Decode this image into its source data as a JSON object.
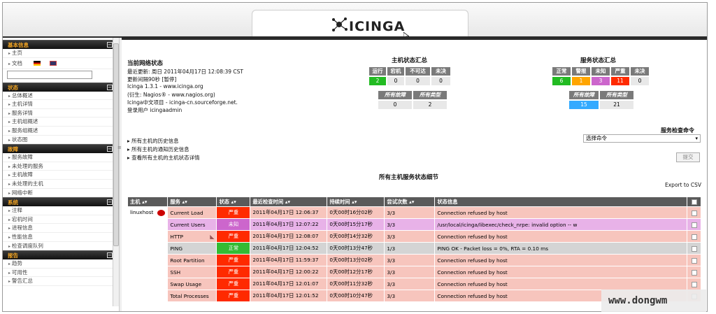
{
  "brand": {
    "logo_text": "ICINGA"
  },
  "sidebar": {
    "sections": [
      {
        "title": "基本信息",
        "items": [
          "主页"
        ]
      },
      {
        "title": "状态",
        "items": [
          "总体概述",
          "主机详情",
          "服务详情",
          "主机组概述",
          "服务组概述",
          "状态图"
        ]
      },
      {
        "title": "故障",
        "items": [
          "服务故障",
          "未处理的服务",
          "主机故障",
          "未处理的主机",
          "网络中断"
        ]
      },
      {
        "title": "系统",
        "items": [
          "注释",
          "宕机时间",
          "进程信息",
          "性能信息",
          "检查调度队列"
        ]
      },
      {
        "title": "报告",
        "items": [
          "趋势",
          "可用性",
          "警告汇总"
        ]
      }
    ],
    "docs_label": "文档",
    "search_value": ""
  },
  "info": {
    "title": "当前网络状态",
    "updated": "最近更新: 周日 2011年04月17日 12:08:39 CST",
    "interval": "更新间隔90秒 [暂停]",
    "version": "Icinga 1.3.1 - www.icinga.org",
    "fork": "(衍生: Nagios® - www.nagios.org)",
    "cn_project": "Icinga中文项目 - icinga-cn.sourceforge.net.",
    "user": "登录用户 icingaadmin"
  },
  "host_summary": {
    "title": "主机状态汇总",
    "headers": [
      "运行",
      "宕机",
      "不可达",
      "未决"
    ],
    "values": [
      "2",
      "0",
      "0",
      "0"
    ],
    "sub_headers": [
      "所有故障",
      "所有类型"
    ],
    "sub_values": [
      "0",
      "2"
    ]
  },
  "service_summary": {
    "title": "服务状态汇总",
    "headers": [
      "正常",
      "警报",
      "未知",
      "严重",
      "未决"
    ],
    "values": [
      "6",
      "1",
      "3",
      "11",
      "0"
    ],
    "sub_headers": [
      "所有故障",
      "所有类型"
    ],
    "sub_values": [
      "15",
      "21"
    ]
  },
  "links": [
    "所有主机的历史信息",
    "所有主机的通知历史信息",
    "查看所有主机的主机状态详情"
  ],
  "command": {
    "title": "服务检查命令",
    "select_value": "选择命令",
    "submit": "提交"
  },
  "details": {
    "title": "所有主机服务状态细节",
    "export": "Export to CSV"
  },
  "table": {
    "headers": [
      "主机",
      "服务",
      "状态",
      "最近检查时间",
      "持续时间",
      "尝试次数",
      "状态信息"
    ],
    "host": "linuxhost",
    "rows": [
      {
        "service": "Current Load",
        "status": "严重",
        "kind": "crit",
        "last": "2011年04月17日 12:06:37",
        "dur": "0天00时16分02秒",
        "att": "3/3",
        "info": "Connection refused by host"
      },
      {
        "service": "Current Users",
        "status": "未知",
        "kind": "unk",
        "last": "2011年04月17日 12:07:22",
        "dur": "0天00时15分17秒",
        "att": "3/3",
        "info": "/usr/local/icinga/libexec/check_nrpe: invalid option -- w"
      },
      {
        "service": "HTTP",
        "status": "严重",
        "kind": "crit",
        "last": "2011年04月17日 12:08:07",
        "dur": "0天00时14分32秒",
        "att": "3/3",
        "info": "Connection refused by host"
      },
      {
        "service": "PING",
        "status": "正常",
        "kind": "ok",
        "last": "2011年04月17日 12:04:52",
        "dur": "0天00时13分47秒",
        "att": "1/3",
        "info": "PING OK - Packet loss = 0%, RTA = 0.10 ms"
      },
      {
        "service": "Root Partition",
        "status": "严重",
        "kind": "crit",
        "last": "2011年04月17日 11:59:37",
        "dur": "0天00时13分02秒",
        "att": "3/3",
        "info": "Connection refused by host"
      },
      {
        "service": "SSH",
        "status": "严重",
        "kind": "crit",
        "last": "2011年04月17日 12:00:22",
        "dur": "0天00时12分17秒",
        "att": "3/3",
        "info": "Connection refused by host"
      },
      {
        "service": "Swap Usage",
        "status": "严重",
        "kind": "crit",
        "last": "2011年04月17日 12:01:07",
        "dur": "0天00时11分32秒",
        "att": "3/3",
        "info": "Connection refused by host"
      },
      {
        "service": "Total Processes",
        "status": "严重",
        "kind": "crit",
        "last": "2011年04月17日 12:01:52",
        "dur": "0天00时10分47秒",
        "att": "3/3",
        "info": "Connection refused by host"
      }
    ]
  },
  "watermark": "www.dongwm"
}
